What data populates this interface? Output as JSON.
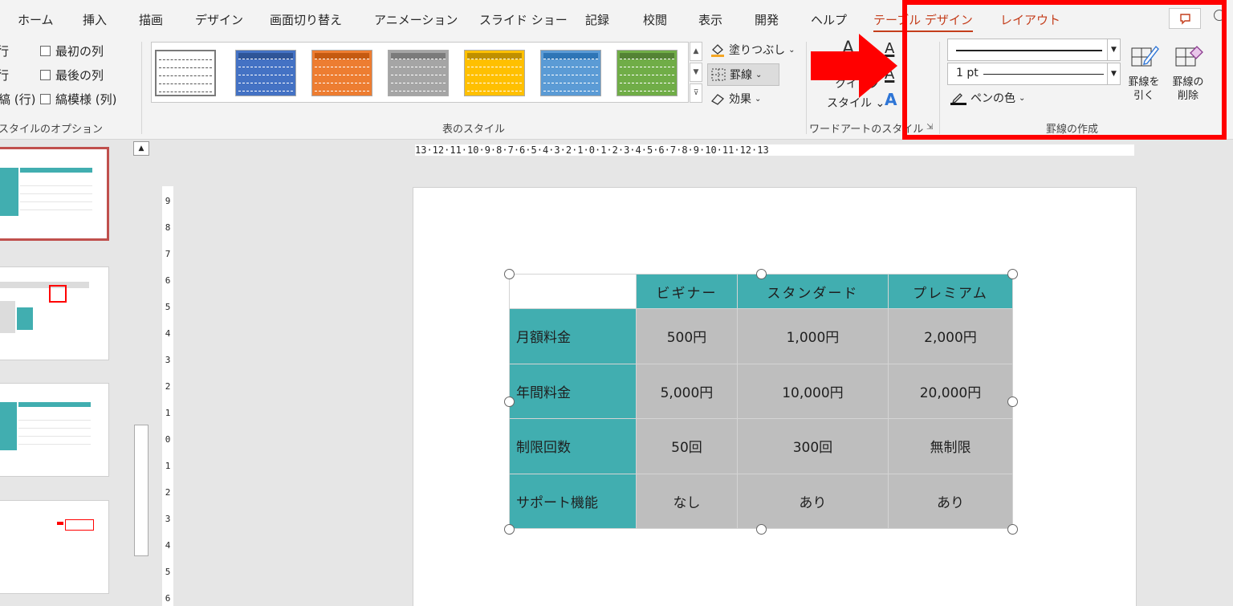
{
  "tabs": [
    "ホーム",
    "挿入",
    "描画",
    "デザイン",
    "画面切り替え",
    "アニメーション",
    "スライド ショー",
    "記録",
    "校閲",
    "表示",
    "開発",
    "ヘルプ",
    "テーブル デザイン",
    "レイアウト"
  ],
  "style_options": {
    "cut_items": [
      "行",
      "行",
      "縞 (行)"
    ],
    "checkboxes": [
      "最初の列",
      "最後の列",
      "縞模様 (列)"
    ],
    "group_label": "スタイルのオプション"
  },
  "table_styles": {
    "group_label": "表のスタイル",
    "shading_label": "塗りつぶし",
    "border_label": "罫線",
    "effects_label": "効果"
  },
  "wordart": {
    "quick_styles_label": "クイック",
    "styles_label": "スタイル",
    "group_label": "ワードアートのスタイル"
  },
  "draw_borders": {
    "pen_weight": "1 pt",
    "pen_color_label": "ペンの色",
    "draw_table_label_1": "罫線を",
    "draw_table_label_2": "引く",
    "eraser_label_1": "罫線の",
    "eraser_label_2": "削除",
    "group_label": "罫線の作成"
  },
  "ruler": {
    "horizontal": "13·12·11·10·9·8·7·6·5·4·3·2·1·0·1·2·3·4·5·6·7·8·9·10·11·12·13",
    "vertical": [
      "9",
      "8",
      "7",
      "6",
      "5",
      "4",
      "3",
      "2",
      "1",
      "0",
      "1",
      "2",
      "3",
      "4",
      "5",
      "6"
    ]
  },
  "slide_table": {
    "headers": [
      "",
      "ビギナー",
      "スタンダード",
      "プレミアム"
    ],
    "rows": [
      [
        "月額料金",
        "500円",
        "1,000円",
        "2,000円"
      ],
      [
        "年間料金",
        "5,000円",
        "10,000円",
        "20,000円"
      ],
      [
        "制限回数",
        "50回",
        "300回",
        "無制限"
      ],
      [
        "サポート機能",
        "なし",
        "あり",
        "あり"
      ]
    ]
  },
  "colors": {
    "accent_tab": "#c43e1c",
    "table_header": "#41aeb0",
    "table_cell": "#bebebe",
    "highlight": "#ff0000"
  },
  "icons": [
    "paint-bucket-icon",
    "border-icon",
    "effects-icon",
    "pen-color-icon",
    "draw-table-icon",
    "eraser-icon",
    "comment-icon"
  ]
}
